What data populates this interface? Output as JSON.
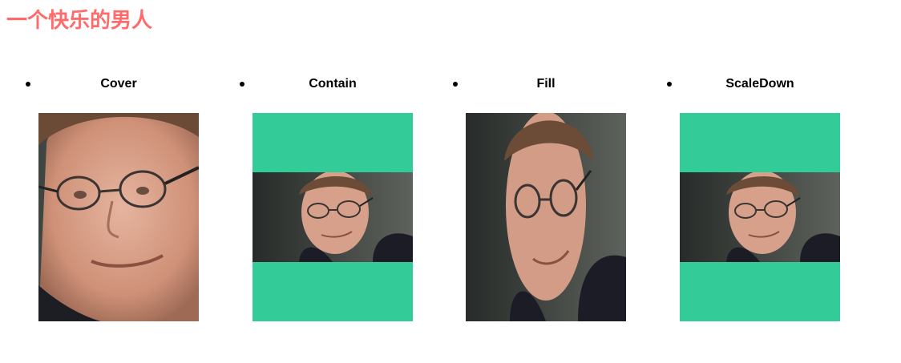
{
  "page": {
    "title": "一个快乐的男人",
    "title_color": "#ff6b6b"
  },
  "demo": {
    "frame_background": "#33cc99",
    "items": [
      {
        "label": "Cover",
        "fit": "cover"
      },
      {
        "label": "Contain",
        "fit": "contain"
      },
      {
        "label": "Fill",
        "fit": "fill"
      },
      {
        "label": "ScaleDown",
        "fit": "scale-down"
      }
    ]
  },
  "icons": {
    "bullet": "bullet-dot-icon",
    "photo": "portrait-photo"
  }
}
